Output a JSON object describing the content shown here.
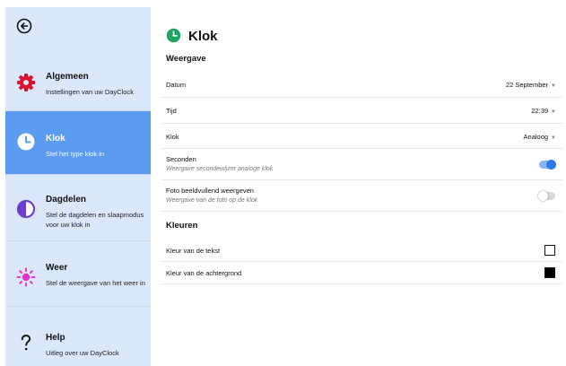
{
  "sidebar": {
    "items": [
      {
        "title": "Algemeen",
        "desc": "Instellingen van uw DayClock"
      },
      {
        "title": "Klok",
        "desc": "Stel het type klok in"
      },
      {
        "title": "Dagdelen",
        "desc": "Stel de dagdelen en slaapmodus voor uw klok in"
      },
      {
        "title": "Weer",
        "desc": "Stel de weergave van het weer in"
      },
      {
        "title": "Help",
        "desc": "Uitleg over uw DayClock"
      }
    ]
  },
  "main": {
    "title": "Klok",
    "section_display": "Weergave",
    "rows": [
      {
        "label": "Datum",
        "value": "22 September"
      },
      {
        "label": "Tijd",
        "value": "22:39"
      },
      {
        "label": "Klok",
        "value": "Analoog"
      },
      {
        "label": "Seconden",
        "sub": "Weergave secondewijzer analoge klok",
        "toggle": true
      },
      {
        "label": "Foto beeldvullend weergeven",
        "sub": "Weergave van de foto op de klok",
        "toggle": false
      }
    ],
    "section_colors": "Kleuren",
    "color_rows": [
      {
        "label": "Kleur van de tekst",
        "color": "#ffffff"
      },
      {
        "label": "Kleur van de achtergrond",
        "color": "#000000"
      }
    ]
  },
  "colors": {
    "sidebar_bg": "#dbe8fb",
    "active_bg": "#5b9cf1",
    "accent_green": "#1fa463",
    "toggle_on": "#2f79e9",
    "algemeen_icon": "#e0102f",
    "dagdelen_icon": "#6a3fd2",
    "weer_icon": "#e72fd2"
  },
  "icons": {
    "back": "back-arrow-icon",
    "algemeen": "gear-icon",
    "klok": "clock-icon",
    "dagdelen": "half-circle-icon",
    "weer": "sun-icon",
    "help": "question-icon",
    "title": "clock-icon"
  }
}
